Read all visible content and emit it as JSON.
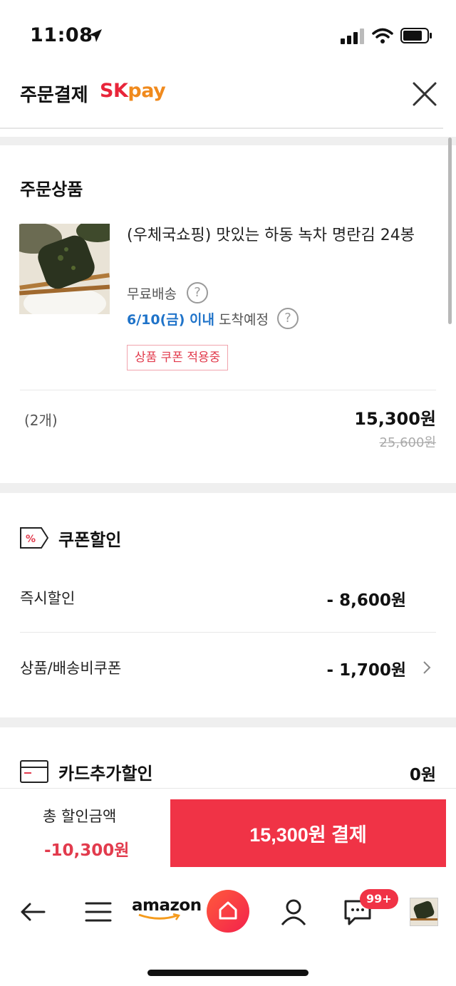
{
  "status_bar": {
    "time": "11:08"
  },
  "header": {
    "title": "주문결제",
    "brand_sk": "SK",
    "brand_pay": "pay"
  },
  "order_products": {
    "section_title": "주문상품",
    "product": {
      "name": "(우체국쇼핑) 맛있는 하동 녹차 명란김 24봉",
      "shipping": "무료배송",
      "arrival_date": "6/10(금) 이내",
      "arrival_text": "도착예정",
      "coupon_badge": "상품 쿠폰 적용중",
      "quantity": "(2개)",
      "price": "15,300원",
      "original_price": "25,600원"
    }
  },
  "coupon_discount": {
    "section_title": "쿠폰할인",
    "instant_label": "즉시할인",
    "instant_value": "- 8,600원",
    "coupon_label": "상품/배송비쿠폰",
    "coupon_value": "- 1,700원"
  },
  "card_discount": {
    "section_title": "카드추가할인",
    "value": "0원"
  },
  "pay_bar": {
    "total_label": "총 할인금액",
    "total_amount": "-10,300원",
    "pay_button": "15,300원 결제"
  },
  "bottom_nav": {
    "amazon": "amazon",
    "chat_badge": "99+"
  },
  "colors": {
    "accent_red": "#f03346",
    "link_blue": "#1f73c9",
    "sk_red": "#e8253a",
    "sk_orange": "#f08a1d"
  }
}
